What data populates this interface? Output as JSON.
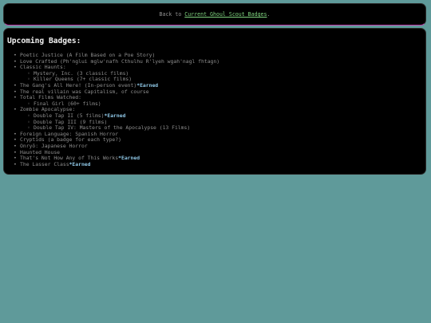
{
  "banner": {
    "prefix": "Back to ",
    "link": "Current Ghoul Scout Badges",
    "suffix": "."
  },
  "heading": "Upcoming Badges:",
  "earned_label": "*Earned",
  "items": [
    {
      "text": "Poetic Justice (A Film Based on a Poe Story)"
    },
    {
      "text": "Love Crafted (Ph'nglui mglw'nafh Cthulhu R'lyeh wgah'nagl fhtagn)"
    },
    {
      "text": "Classic Haunts:",
      "sub": [
        {
          "text": "Mystery, Inc. (3 classic films)"
        },
        {
          "text": "Killer Queens (7+ classic films)"
        }
      ]
    },
    {
      "text": "The Gang's All Here! (In-person event)",
      "earned": true
    },
    {
      "text": "The real villain was Capitalism, of course"
    },
    {
      "text": "Total Films Watched:",
      "sub": [
        {
          "text": "Final Girl (60+ films)"
        }
      ]
    },
    {
      "text": "Zombie Apocalypse:",
      "sub": [
        {
          "text": "Double Tap II (5 films)",
          "earned": true
        },
        {
          "text": "Double Tap III (9 films)"
        },
        {
          "text": "Double Tap IV: Masters of the Apocalypse (13 Films)"
        }
      ]
    },
    {
      "text": "Foreign Language: Spanish Horror"
    },
    {
      "text": "Cryptids (a badge for each type?)"
    },
    {
      "text": "Onryō: Japanese Horror"
    },
    {
      "text": "Haunted House"
    },
    {
      "text": "That's Not How Any of This Works",
      "earned": true
    },
    {
      "text": "The Lasser Class",
      "earned": true
    }
  ]
}
